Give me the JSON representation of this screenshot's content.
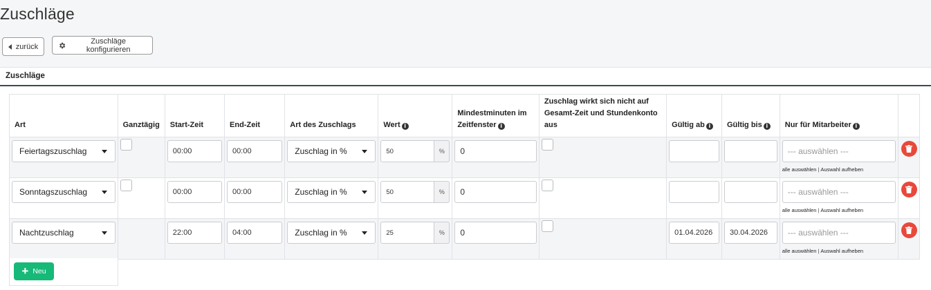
{
  "page": {
    "title": "Zuschläge"
  },
  "toolbar": {
    "back_label": "zurück",
    "config_label": "Zuschläge konfigurieren"
  },
  "panel": {
    "title": "Zuschläge"
  },
  "table": {
    "headers": {
      "art": "Art",
      "ganztaegig": "Ganztägig",
      "start": "Start-Zeit",
      "end": "End-Zeit",
      "art_zuschlag": "Art des Zuschlags",
      "wert": "Wert",
      "mindest": "Mindestminuten im Zeitfenster",
      "wirkt": "Zuschlag wirkt sich nicht auf Gesamt-Zeit und Stundenkonto aus",
      "gueltig_ab": "Gültig ab",
      "gueltig_bis": "Gültig bis",
      "mitarbeiter": "Nur für Mitarbeiter"
    },
    "rows": [
      {
        "art": "Feiertagszuschlag",
        "start": "00:00",
        "end": "00:00",
        "art_zuschlag": "Zuschlag in %",
        "wert": "50",
        "unit": "%",
        "mindest": "0",
        "gueltig_ab": "",
        "gueltig_bis": "",
        "mitarbeiter_placeholder": "--- auswählen ---",
        "select_all": "alle auswählen",
        "deselect": "Auswahl aufheben"
      },
      {
        "art": "Sonntagszuschlag",
        "start": "00:00",
        "end": "00:00",
        "art_zuschlag": "Zuschlag in %",
        "wert": "50",
        "unit": "%",
        "mindest": "0",
        "gueltig_ab": "",
        "gueltig_bis": "",
        "mitarbeiter_placeholder": "--- auswählen ---",
        "select_all": "alle auswählen",
        "deselect": "Auswahl aufheben"
      },
      {
        "art": "Nachtzuschlag",
        "start": "22:00",
        "end": "04:00",
        "art_zuschlag": "Zuschlag in %",
        "wert": "25",
        "unit": "%",
        "mindest": "0",
        "gueltig_ab": "01.04.2026",
        "gueltig_bis": "30.04.2026",
        "mitarbeiter_placeholder": "--- auswählen ---",
        "select_all": "alle auswählen",
        "deselect": "Auswahl aufheben"
      }
    ]
  },
  "new_button": {
    "label": "Neu"
  },
  "colors": {
    "accent_green": "#17b978",
    "delete_red": "#e8493b",
    "header_line": "#3b4a52"
  }
}
